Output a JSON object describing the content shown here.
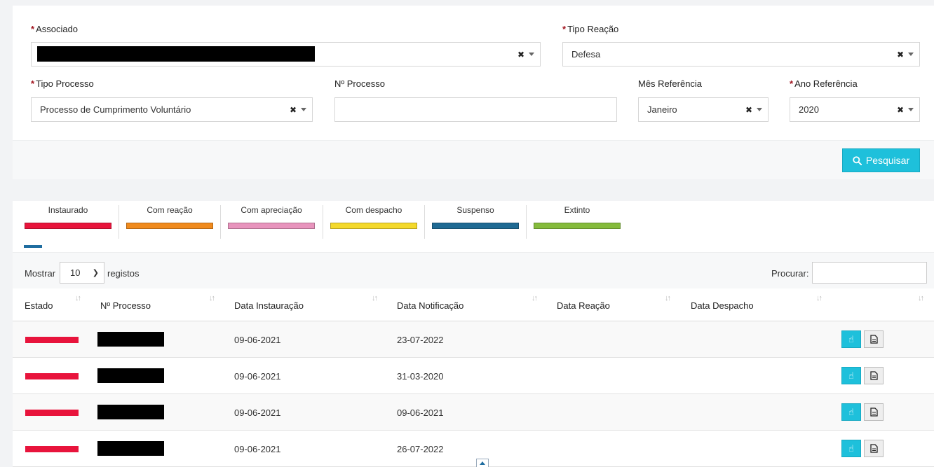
{
  "filters": {
    "associado": {
      "label": "Associado",
      "required": true,
      "value": ""
    },
    "tipo_reacao": {
      "label": "Tipo Reação",
      "required": true,
      "value": "Defesa"
    },
    "tipo_processo": {
      "label": "Tipo Processo",
      "required": true,
      "value": "Processo de Cumprimento Voluntário"
    },
    "n_processo": {
      "label": "Nº Processo",
      "required": false,
      "value": ""
    },
    "mes_referencia": {
      "label": "Mês Referência",
      "required": false,
      "value": "Janeiro"
    },
    "ano_referencia": {
      "label": "Ano Referência",
      "required": true,
      "value": "2020"
    },
    "required_mark": "*",
    "clear_symbol": "✖",
    "search_button_label": "Pesquisar"
  },
  "legend": [
    {
      "label": "Instaurado",
      "color": "#e8143c"
    },
    {
      "label": "Com reação",
      "color": "#f08a1c"
    },
    {
      "label": "Com apreciação",
      "color": "#e894bd"
    },
    {
      "label": "Com despacho",
      "color": "#f4d92b"
    },
    {
      "label": "Suspenso",
      "color": "#1f6a93"
    },
    {
      "label": "Extinto",
      "color": "#85bb3c"
    }
  ],
  "table_controls": {
    "show_label": "Mostrar",
    "page_length": "10",
    "records_label": "registos",
    "search_label": "Procurar:",
    "search_value": ""
  },
  "table": {
    "columns": [
      "Estado",
      "Nº Processo",
      "Data Instauração",
      "Data Notificação",
      "Data Reação",
      "Data Despacho",
      ""
    ],
    "rows": [
      {
        "estado_color": "#e8143c",
        "data_instauracao": "09-06-2021",
        "data_notificacao": "23-07-2022",
        "data_reacao": "",
        "data_despacho": ""
      },
      {
        "estado_color": "#e8143c",
        "data_instauracao": "09-06-2021",
        "data_notificacao": "31-03-2020",
        "data_reacao": "",
        "data_despacho": ""
      },
      {
        "estado_color": "#e8143c",
        "data_instauracao": "09-06-2021",
        "data_notificacao": "09-06-2021",
        "data_reacao": "",
        "data_despacho": ""
      },
      {
        "estado_color": "#e8143c",
        "data_instauracao": "09-06-2021",
        "data_notificacao": "26-07-2022",
        "data_reacao": "",
        "data_despacho": ""
      }
    ],
    "row_action_icons": [
      "hand-pointer-icon",
      "document-icon"
    ]
  },
  "colors": {
    "accent": "#1ec0db",
    "required": "#a1141e"
  }
}
